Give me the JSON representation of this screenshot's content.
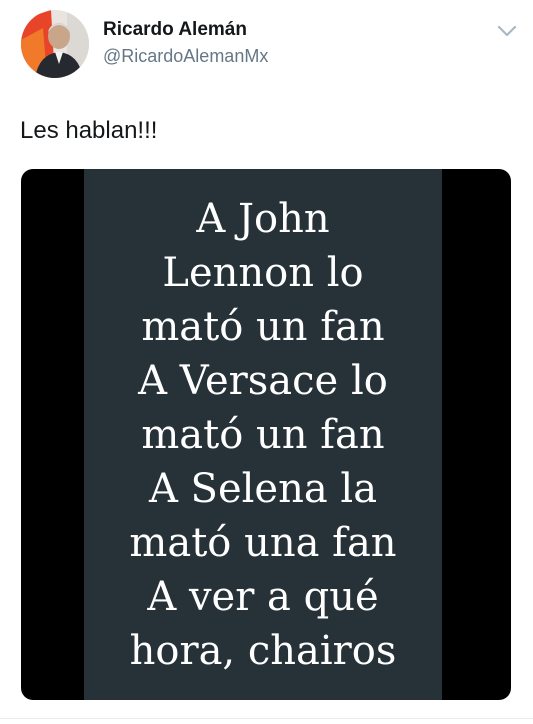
{
  "author": {
    "name": "Ricardo Alemán",
    "handle": "@RicardoAlemanMx",
    "avatar_icon": "profile-photo"
  },
  "menu_icon": "chevron-down-icon",
  "tweet": {
    "text": "Les hablan!!!"
  },
  "media": {
    "background_color": "#000000",
    "panel_color": "#263238",
    "text_color": "#ffffff",
    "lines": [
      "A John",
      "Lennon lo",
      "mató un fan",
      "A Versace lo",
      "mató un fan",
      "A Selena la",
      "mató una fan",
      "A ver a qué",
      "hora, chairos"
    ]
  },
  "colors": {
    "name": "#14171a",
    "handle": "#657786",
    "chevron": "#aab8c2"
  }
}
